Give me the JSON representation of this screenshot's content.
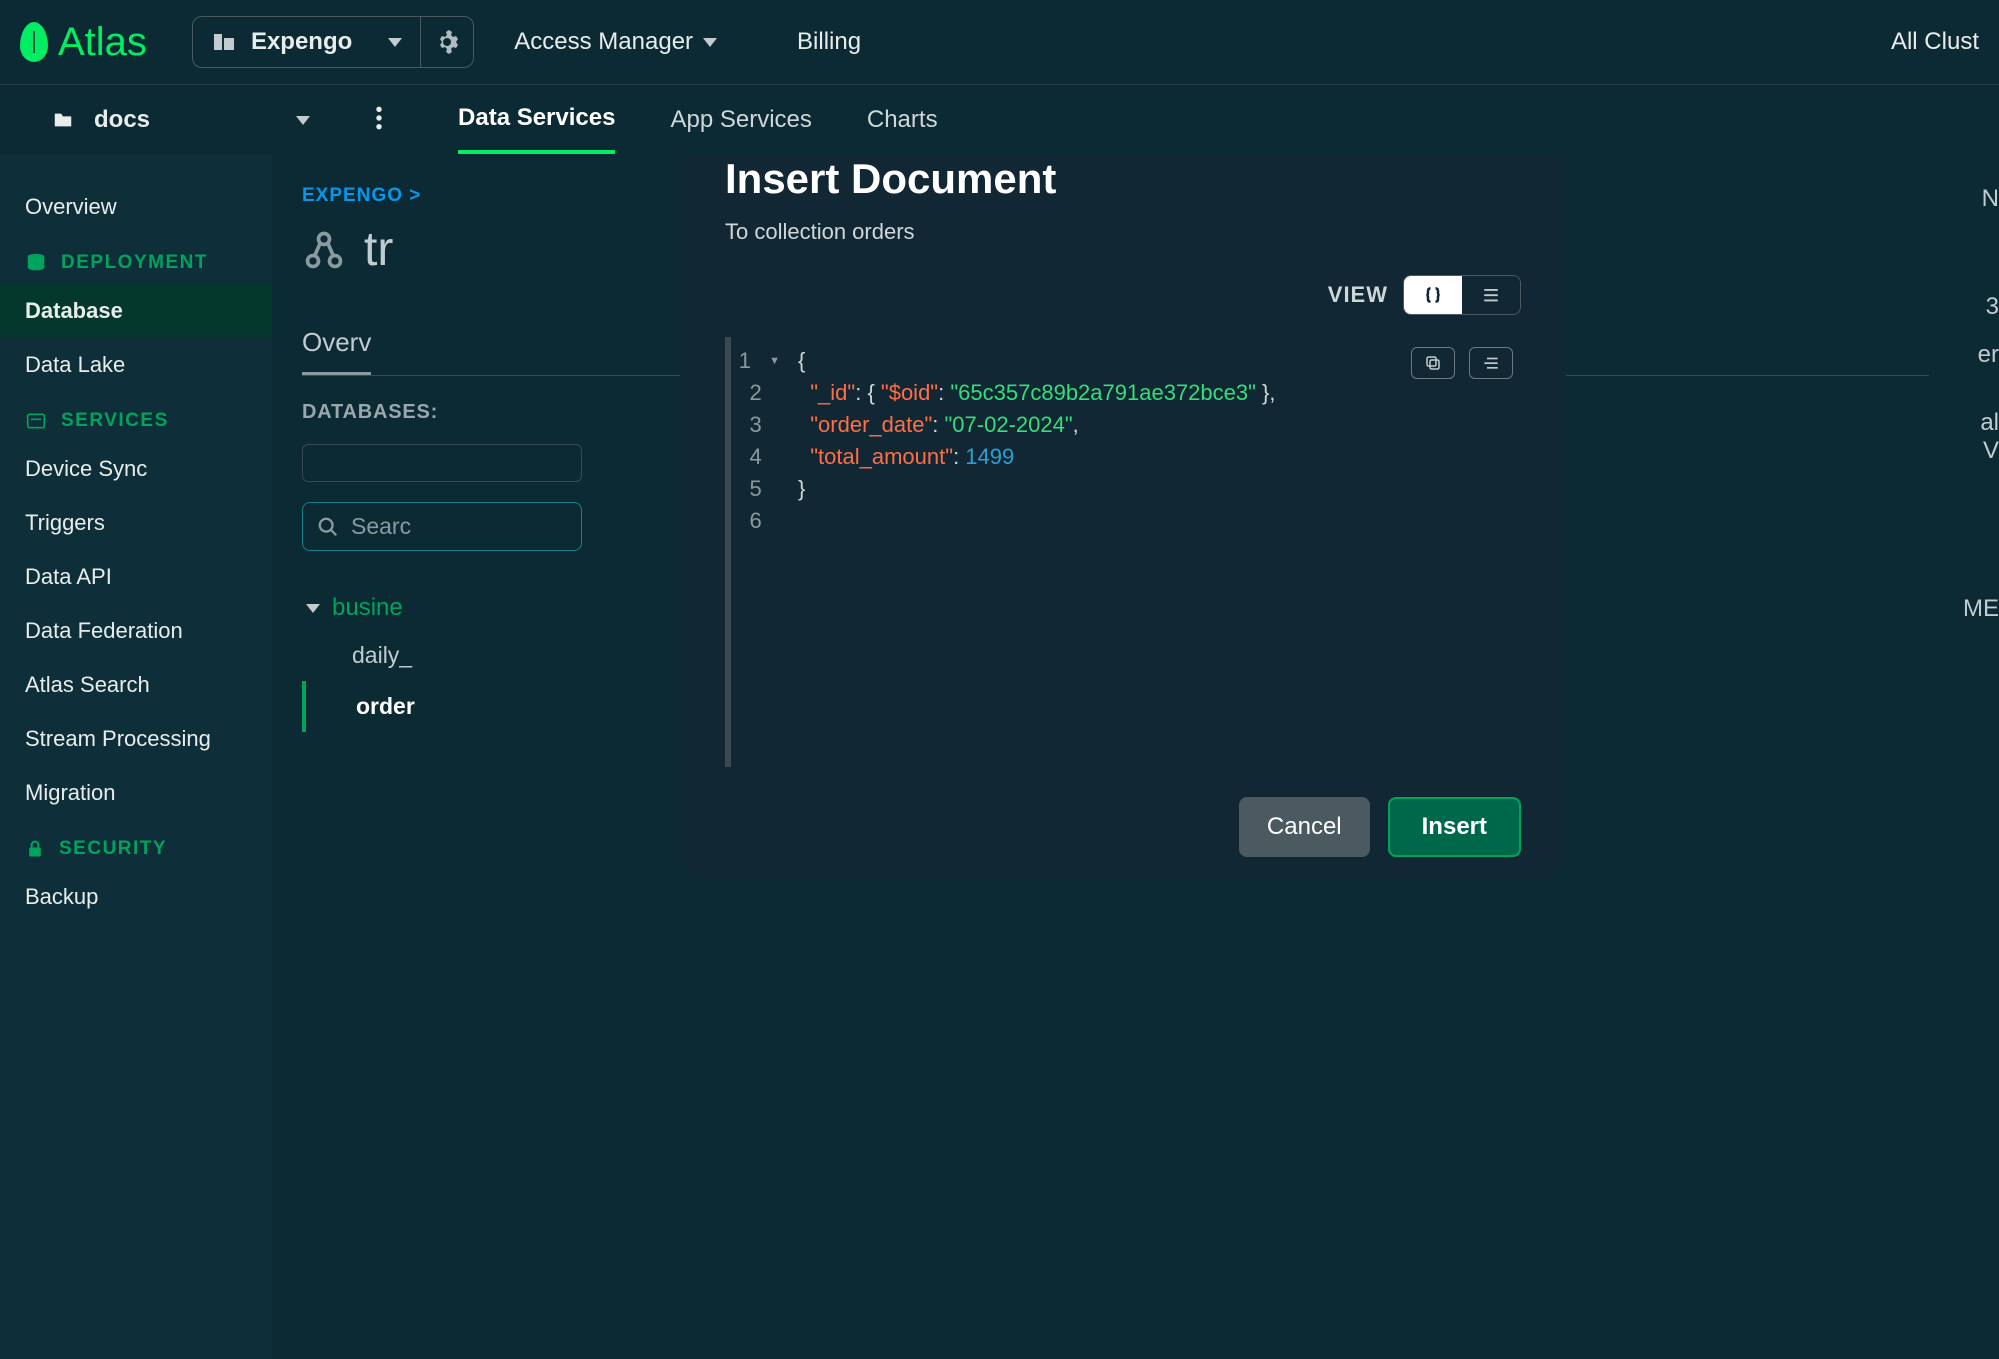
{
  "brand": "Atlas",
  "org": {
    "name": "Expengo"
  },
  "topnav": {
    "access": "Access Manager",
    "billing": "Billing",
    "allclust": "All Clust"
  },
  "project": {
    "name": "docs"
  },
  "tabs": {
    "data": "Data Services",
    "app": "App Services",
    "charts": "Charts"
  },
  "sidebar": {
    "overview": "Overview",
    "deployment_header": "DEPLOYMENT",
    "database": "Database",
    "datalake": "Data Lake",
    "services_header": "SERVICES",
    "devicesync": "Device Sync",
    "triggers": "Triggers",
    "dataapi": "Data API",
    "datafed": "Data Federation",
    "atlassearch": "Atlas Search",
    "stream": "Stream Processing",
    "migration": "Migration",
    "security_header": "SECURITY",
    "backup": "Backup"
  },
  "main": {
    "breadcrumb": "EXPENGO >",
    "cluster": "tr",
    "subtab_overview": "Overv",
    "databases_label": "DATABASES:",
    "search_placeholder": "Searc",
    "db_name": "busine",
    "coll_daily": "daily_",
    "coll_orders": "order"
  },
  "edge": {
    "a": "N",
    "b": "3",
    "c": "er",
    "d": "al V",
    "e": "ME"
  },
  "modal": {
    "title": "Insert Document",
    "subtitle": "To collection orders",
    "view_label": "VIEW",
    "cancel": "Cancel",
    "insert": "Insert",
    "code": {
      "lines": [
        "1",
        "2",
        "3",
        "4",
        "5",
        "6"
      ],
      "id_key": "\"_id\"",
      "oid_key": "\"$oid\"",
      "oid_val": "\"65c357c89b2a791ae372bce3\"",
      "date_key": "\"order_date\"",
      "date_val": "\"07-02-2024\"",
      "amount_key": "\"total_amount\"",
      "amount_val": "1499"
    }
  }
}
